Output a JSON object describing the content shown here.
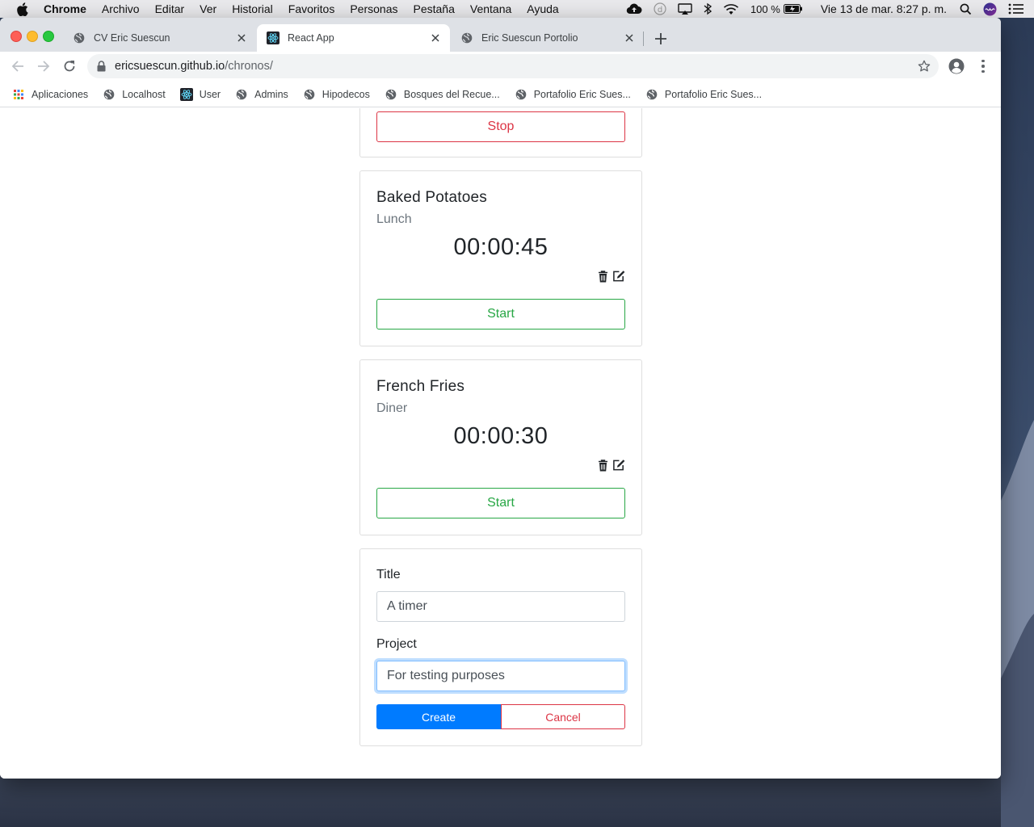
{
  "menubar": {
    "items": [
      "Chrome",
      "Archivo",
      "Editar",
      "Ver",
      "Historial",
      "Favoritos",
      "Personas",
      "Pestaña",
      "Ventana",
      "Ayuda"
    ],
    "battery": "100 %",
    "datetime": "Vie 13 de mar.  8:27 p. m.",
    "icons": [
      "apple-icon",
      "cloud-upload-icon",
      "d-circle-icon",
      "airplay-icon",
      "bluetooth-icon",
      "wifi-icon",
      "battery-charging-icon",
      "spotlight-search-icon",
      "siri-icon",
      "notification-center-icon"
    ]
  },
  "tabs": [
    {
      "title": "CV Eric Suescun",
      "icon": "globe-icon",
      "active": false
    },
    {
      "title": "React App",
      "icon": "react-icon",
      "active": true
    },
    {
      "title": "Eric Suescun Portolio",
      "icon": "globe-icon",
      "active": false
    }
  ],
  "toolbar": {
    "url_host": "ericsuescun.github.io",
    "url_path": "/chronos/"
  },
  "bookmarks": [
    {
      "label": "Aplicaciones",
      "icon": "apps-grid-icon"
    },
    {
      "label": "Localhost",
      "icon": "globe-icon"
    },
    {
      "label": "User",
      "icon": "react-icon"
    },
    {
      "label": "Admins",
      "icon": "globe-icon"
    },
    {
      "label": "Hipodecos",
      "icon": "globe-icon"
    },
    {
      "label": "Bosques del Recue...",
      "icon": "globe-icon"
    },
    {
      "label": "Portafolio Eric Sues...",
      "icon": "globe-icon"
    },
    {
      "label": "Portafolio Eric Sues...",
      "icon": "globe-icon"
    }
  ],
  "timers": [
    {
      "stop_label": "Stop"
    },
    {
      "title": "Baked Potatoes",
      "project": "Lunch",
      "elapsed": "00:00:45",
      "start_label": "Start"
    },
    {
      "title": "French Fries",
      "project": "Diner",
      "elapsed": "00:00:30",
      "start_label": "Start"
    }
  ],
  "form": {
    "title_label": "Title",
    "title_value": "A timer",
    "project_label": "Project",
    "project_value": "For testing purposes",
    "create_label": "Create",
    "cancel_label": "Cancel"
  },
  "colors": {
    "start": "#28a745",
    "stop": "#dc3545",
    "primary": "#007bff"
  }
}
